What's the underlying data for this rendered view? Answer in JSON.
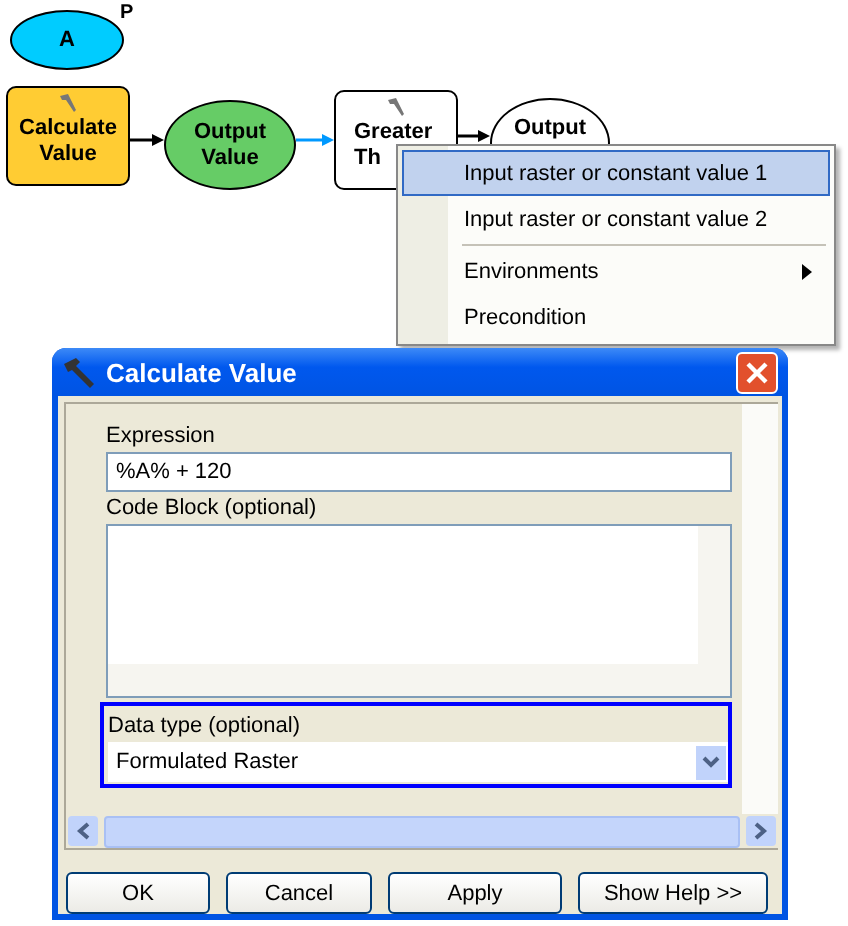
{
  "diagram": {
    "nodes": [
      {
        "kind": "variable",
        "lines": [
          "A"
        ],
        "color": "#00ccff",
        "badge": "P",
        "tool_icon": false
      },
      {
        "kind": "tool",
        "lines": [
          "Calculate",
          "Value"
        ],
        "color": "#ffcc33",
        "tool_icon": true
      },
      {
        "kind": "variable",
        "lines": [
          "Output",
          "Value"
        ],
        "color": "#66cc66",
        "tool_icon": false
      },
      {
        "kind": "tool",
        "lines": [
          "Greater",
          "Th"
        ],
        "color": "#ffffff",
        "tool_icon": true
      },
      {
        "kind": "variable",
        "lines": [
          "Output"
        ],
        "color": "#ffffff",
        "tool_icon": false
      }
    ],
    "connectors": [
      {
        "color": "#000000"
      },
      {
        "color": "#0099ff"
      },
      {
        "color": "#000000"
      }
    ]
  },
  "context_menu": {
    "items": [
      {
        "kind": "item",
        "label": "Input raster or constant value 1",
        "selected": true,
        "submenu": false
      },
      {
        "kind": "item",
        "label": "Input raster or constant value 2",
        "selected": false,
        "submenu": false
      },
      {
        "kind": "separator"
      },
      {
        "kind": "item",
        "label": "Environments",
        "selected": false,
        "submenu": true
      },
      {
        "kind": "item",
        "label": "Precondition",
        "selected": false,
        "submenu": false
      }
    ]
  },
  "dialog": {
    "title": "Calculate Value",
    "expression": {
      "label": "Expression",
      "value": "%A% + 120"
    },
    "code_block": {
      "label": "Code Block (optional)"
    },
    "data_type": {
      "label": "Data type (optional)",
      "value": "Formulated Raster",
      "highlighted": true
    },
    "buttons": [
      "OK",
      "Cancel",
      "Apply",
      "Show Help >>"
    ]
  }
}
